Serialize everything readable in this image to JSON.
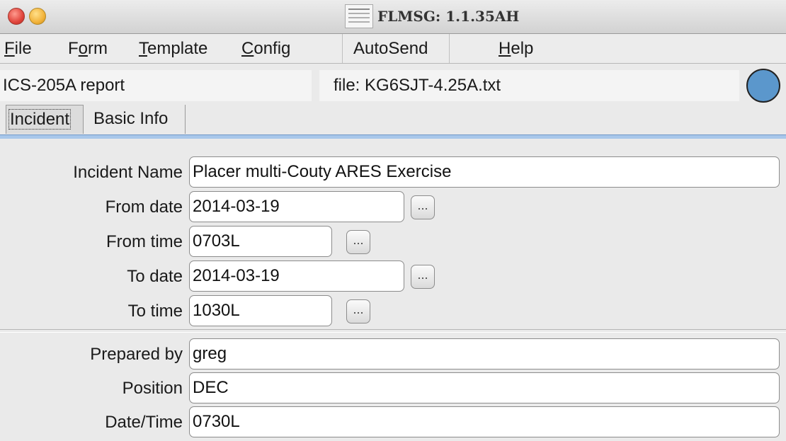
{
  "window": {
    "title": "FLMSG: 1.1.35AH"
  },
  "menu": {
    "file": "File",
    "form": "Form",
    "template": "Template",
    "config": "Config",
    "autosend": "AutoSend",
    "help": "Help"
  },
  "info": {
    "report": "ICS-205A report",
    "file": "file: KG6SJT-4.25A.txt",
    "status_color": "#5b97cc"
  },
  "tabs": [
    {
      "label": "Incident",
      "active": true
    },
    {
      "label": "Basic Info",
      "active": false
    }
  ],
  "form": {
    "incident_name": {
      "label": "Incident Name",
      "value": "Placer multi-Couty ARES Exercise"
    },
    "from_date": {
      "label": "From date",
      "value": "2014-03-19"
    },
    "from_time": {
      "label": "From time",
      "value": "0703L"
    },
    "to_date": {
      "label": "To date",
      "value": "2014-03-19"
    },
    "to_time": {
      "label": "To time",
      "value": "1030L"
    },
    "prepared_by": {
      "label": "Prepared by",
      "value": "greg"
    },
    "position": {
      "label": "Position",
      "value": "DEC"
    },
    "date_time": {
      "label": "Date/Time",
      "value": "0730L"
    },
    "picker_label": "..."
  }
}
